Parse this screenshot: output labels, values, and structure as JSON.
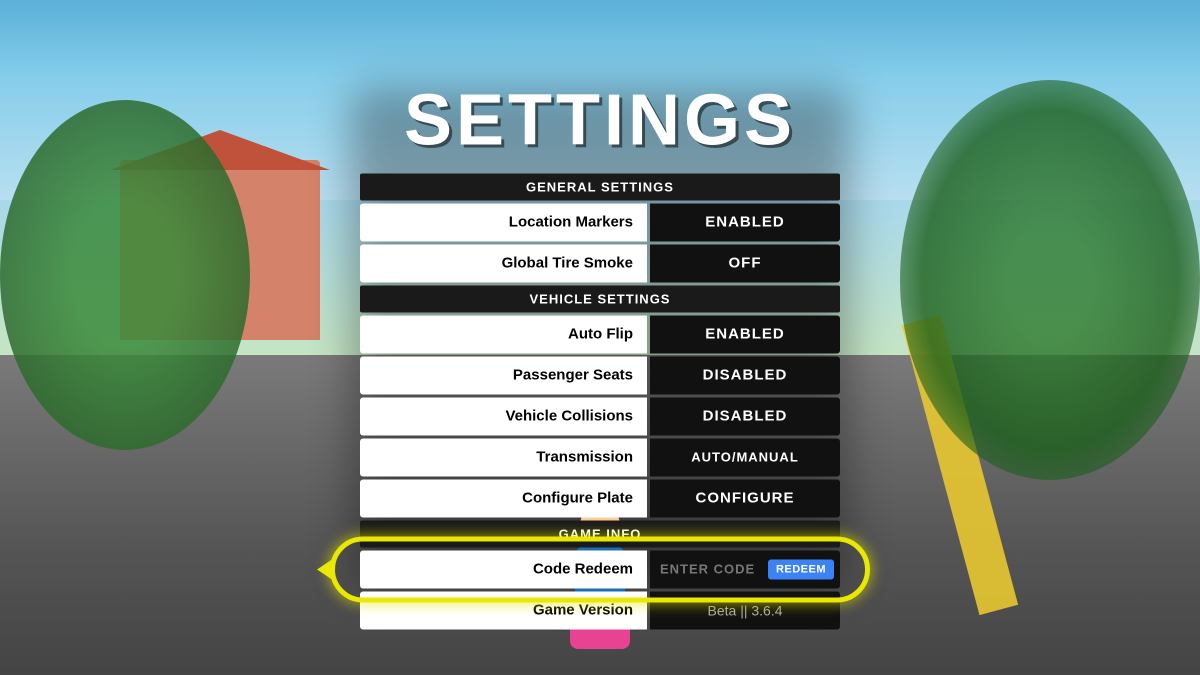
{
  "title": "SETTINGS",
  "sections": {
    "general": {
      "header": "GENERAL SETTINGS",
      "rows": [
        {
          "label": "Location Markers",
          "value": "ENABLED",
          "type": "enabled"
        },
        {
          "label": "Global Tire Smoke",
          "value": "OFF",
          "type": "off"
        }
      ]
    },
    "vehicle": {
      "header": "VEHICLE SETTINGS",
      "rows": [
        {
          "label": "Auto Flip",
          "value": "ENABLED",
          "type": "enabled"
        },
        {
          "label": "Passenger Seats",
          "value": "DISABLED",
          "type": "disabled"
        },
        {
          "label": "Vehicle Collisions",
          "value": "DISABLED",
          "type": "disabled"
        },
        {
          "label": "Transmission",
          "value": "AUTO/MANUAL",
          "type": "auto-manual"
        },
        {
          "label": "Configure Plate",
          "value": "CONFIGURE",
          "type": "configure"
        }
      ]
    },
    "gameInfo": {
      "header": "GAME INFO"
    },
    "codeRedeem": {
      "label": "Code Redeem",
      "placeholder": "ENTER CODE",
      "buttonLabel": "REDEEM"
    },
    "gameVersion": {
      "label": "Game Version",
      "value": "Beta || 3.6.4"
    }
  },
  "colors": {
    "yellow_highlight": "#e8e800",
    "redeem_btn": "#3b82f6",
    "section_header_bg": "#1a1a1a",
    "row_bg_dark": "#111111",
    "row_bg_light": "#ffffff"
  }
}
